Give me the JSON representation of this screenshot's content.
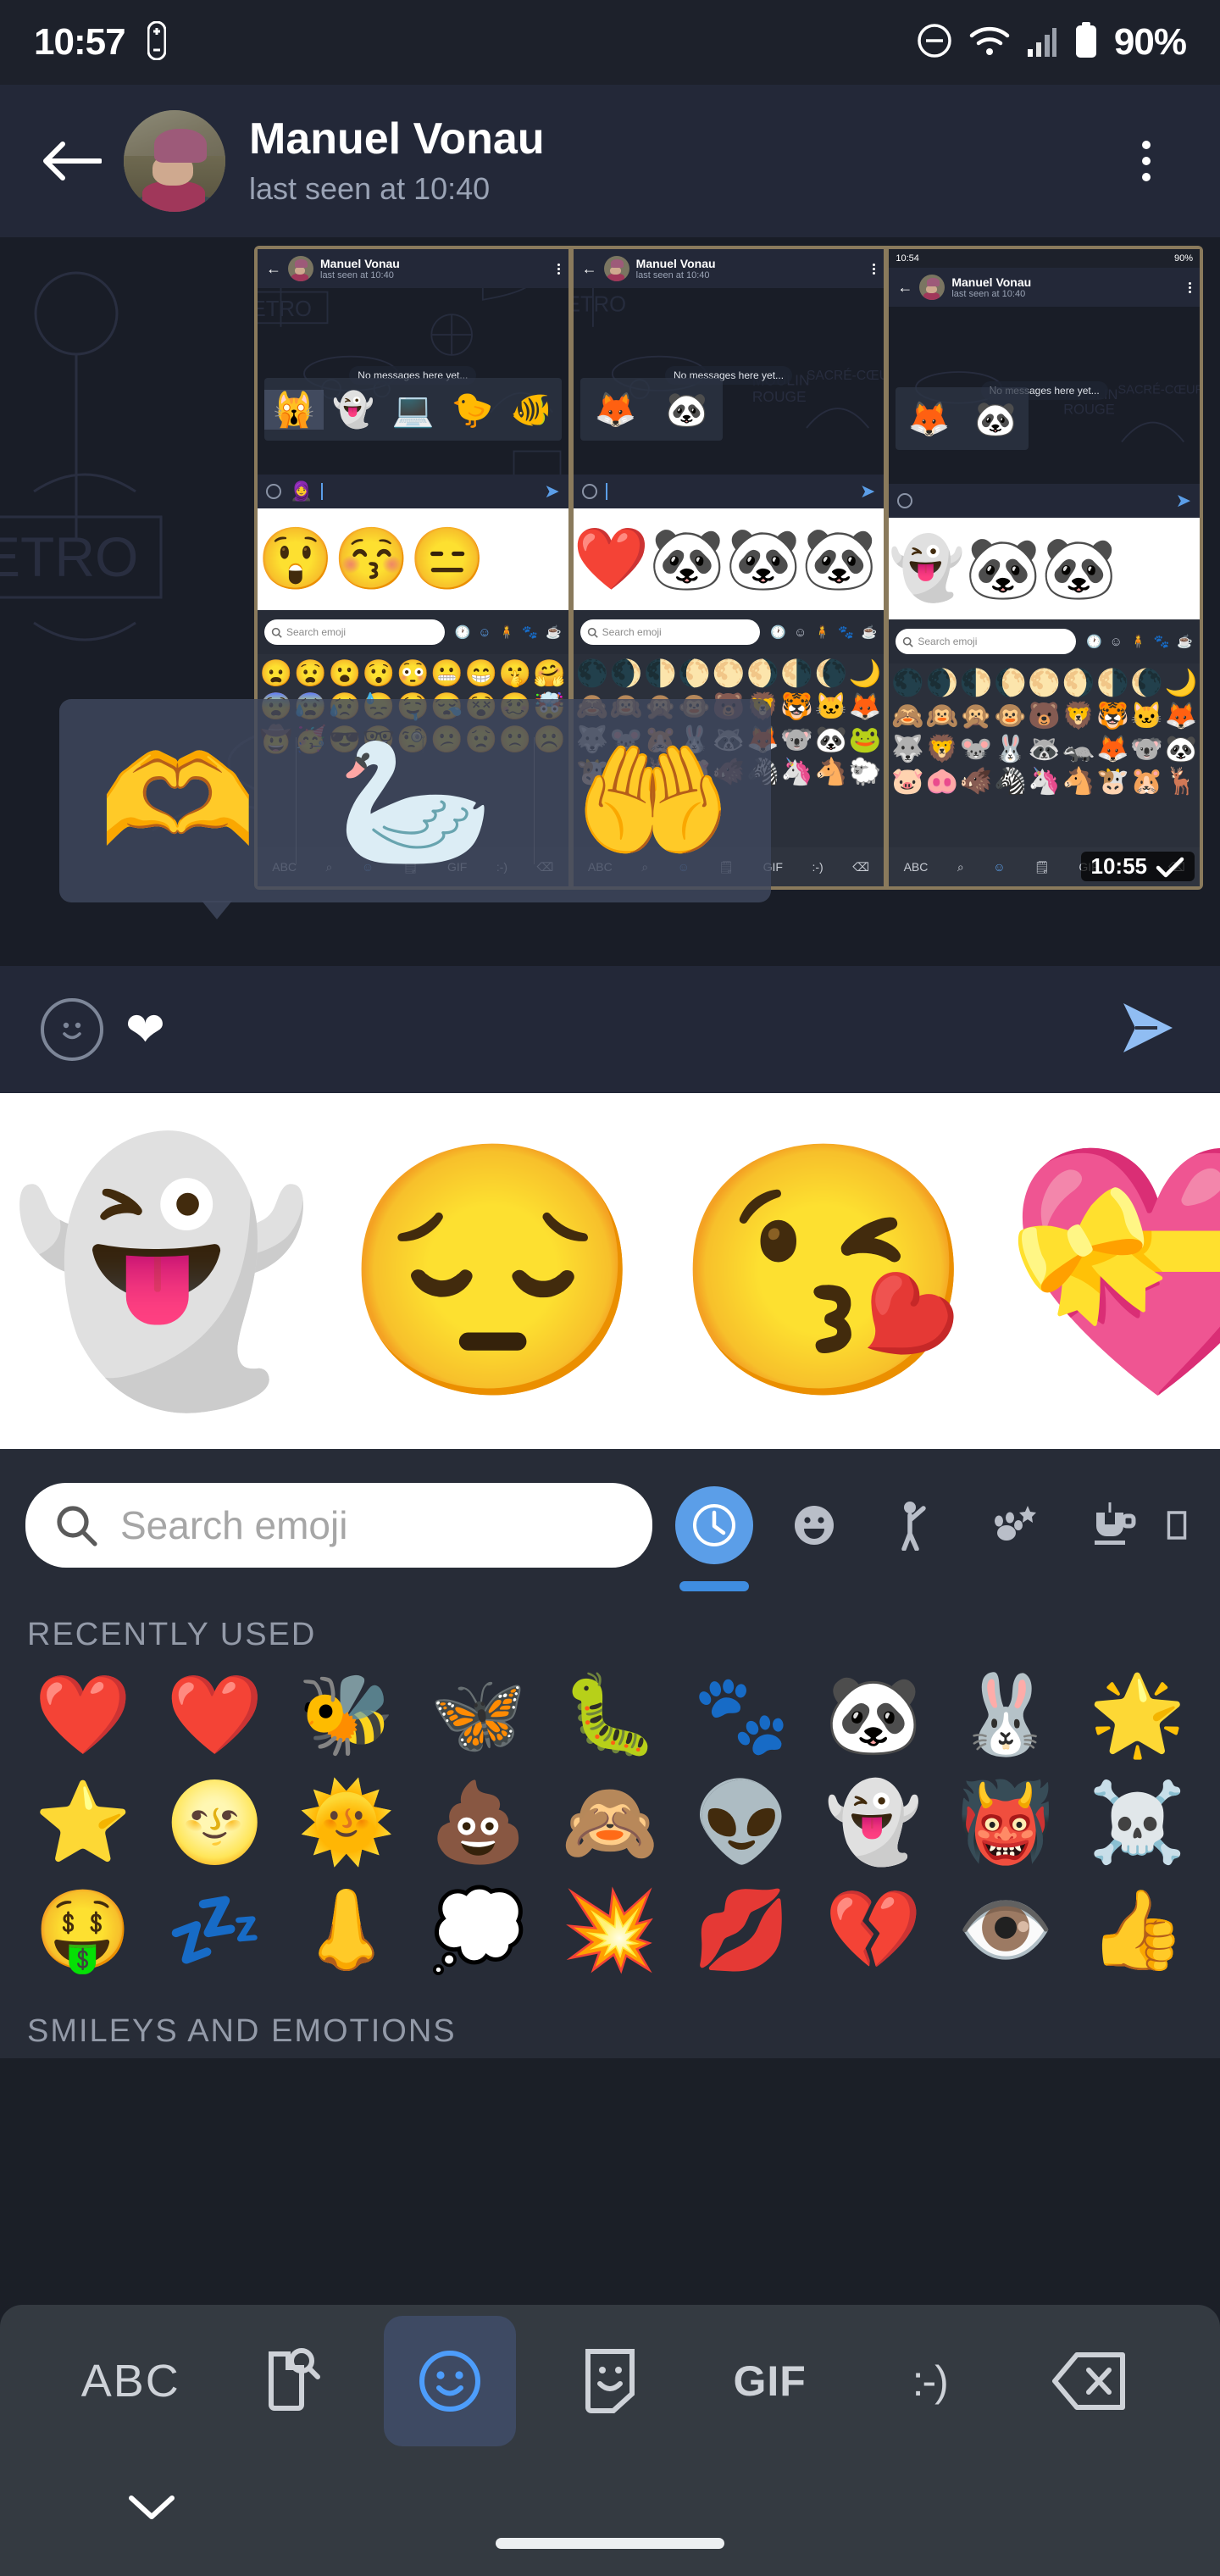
{
  "statusbar": {
    "time": "10:57",
    "battery_percent": "90%",
    "icons": [
      "remote-icon",
      "do-not-disturb-icon",
      "wifi-icon",
      "signal-icon",
      "battery-icon"
    ]
  },
  "header": {
    "title": "Manuel Vonau",
    "subtitle": "last seen at 10:40",
    "back_icon": "back-arrow-icon",
    "menu_icon": "overflow-menu-icon",
    "avatar_name": "contact-avatar"
  },
  "chat": {
    "image_message": {
      "border_color": "#8a7a5c",
      "screenshots": [
        {
          "header_title": "Manuel Vonau",
          "header_subtitle": "last seen at 10:40",
          "empty_text": "No messages here yet...",
          "suggested_stickers": [
            "🙀",
            "👻",
            "💻",
            "🐤",
            "🐠"
          ],
          "input_value": "🧕",
          "preview_emoji": [
            "😲",
            "😚",
            "😑"
          ],
          "search_placeholder": "Search emoji",
          "grid_rows": [
            [
              "😦",
              "😧",
              "😮",
              "😯",
              "😳",
              "😬",
              "😁",
              "🤫",
              "🤗"
            ]
          ],
          "active_tab": "smileys"
        },
        {
          "header_title": "Manuel Vonau",
          "header_subtitle": "last seen at 10:40",
          "empty_text": "No messages here yet...",
          "suggested_stickers": [
            "🦊",
            "🐼"
          ],
          "input_value": "",
          "preview_emoji": [
            "❤️",
            "🐼",
            "🐼",
            "🐼"
          ],
          "search_placeholder": "Search emoji",
          "grid_rows": [
            [
              "🌑",
              "🌒",
              "🌓",
              "🌔",
              "🌕",
              "🌖",
              "🌗",
              "🌘",
              "🌙"
            ],
            [
              "🙈",
              "🙉",
              "🙊",
              "🐵",
              "🐻",
              "🦁",
              "🐯",
              "🐱",
              "🦊"
            ]
          ],
          "active_tab": "animals"
        },
        {
          "status_time": "10:54",
          "status_battery": "90%",
          "header_title": "Manuel Vonau",
          "header_subtitle": "last seen at 10:40",
          "empty_text": "No messages here yet...",
          "suggested_stickers": [
            "🦊",
            "🐼"
          ],
          "input_value": "",
          "preview_emoji": [
            "👻",
            "🐼",
            "🐼"
          ],
          "search_placeholder": "Search emoji",
          "grid_rows": [
            [
              "🌑",
              "🌒",
              "🌓",
              "🌔",
              "🌕",
              "🌖",
              "🌗",
              "🌘",
              "🌙"
            ],
            [
              "🙈",
              "🙉",
              "🙊",
              "🐵",
              "🐻",
              "🦁",
              "🐯",
              "🐱",
              "🦊"
            ],
            [
              "🐺",
              "🦁",
              "🐭",
              "🐰",
              "🦝",
              "🦡",
              "🦊",
              "🐨",
              "🐼"
            ],
            [
              "🐷",
              "🐽",
              "🐗",
              "🦓",
              "🦄",
              "🐴",
              "🐮",
              "🐹",
              "🦌"
            ]
          ],
          "active_tab": "animals",
          "keyboard_label": "ABC",
          "time_overlay": "10:55",
          "check_icon": "checkmark-icon"
        }
      ],
      "sticker_suggestions": [
        "🫶",
        "🦢",
        "🤲"
      ]
    }
  },
  "input_bar": {
    "emoji_button_icon": "smiley-icon",
    "message_text": "❤",
    "send_icon": "send-icon"
  },
  "emoji_kitchen_preview": {
    "items": [
      "👻",
      "😔",
      "😘",
      "💝"
    ]
  },
  "picker": {
    "search": {
      "placeholder": "Search emoji",
      "icon": "search-icon"
    },
    "tabs": [
      {
        "name": "recently-used",
        "icon": "clock-icon",
        "active": true
      },
      {
        "name": "smileys",
        "icon": "smiley-icon",
        "active": false
      },
      {
        "name": "people",
        "icon": "person-icon",
        "active": false
      },
      {
        "name": "animals-nature",
        "icon": "paw-star-icon",
        "active": false
      },
      {
        "name": "food-drink",
        "icon": "cup-icon",
        "active": false
      },
      {
        "name": "travel",
        "icon": "partial-icon",
        "active": false
      }
    ],
    "accent_color": "#5b9ee8",
    "sections": [
      {
        "label": "RECENTLY USED",
        "rows": [
          [
            "❤️",
            "❤️",
            "🐝",
            "🦋",
            "🐛",
            "🐾",
            "🐼",
            "🐰",
            "🌟"
          ],
          [
            "⭐",
            "🌝",
            "🌞",
            "💩",
            "🙈",
            "👽",
            "👻",
            "👹",
            "☠️"
          ],
          [
            "🤑",
            "💤",
            "👃",
            "💭",
            "💥",
            "💋",
            "💔",
            "👁️",
            "👍"
          ]
        ]
      },
      {
        "label": "SMILEYS AND EMOTIONS",
        "rows": []
      }
    ]
  },
  "keyboard_toolbar": {
    "items": [
      {
        "name": "abc-key",
        "label": "ABC",
        "type": "text",
        "active": false
      },
      {
        "name": "sticker-search-key",
        "label": "",
        "type": "icon-sticker-search",
        "active": false
      },
      {
        "name": "emoji-key",
        "label": "",
        "type": "icon-smiley",
        "active": true
      },
      {
        "name": "sticker-key",
        "label": "",
        "type": "icon-sticker",
        "active": false
      },
      {
        "name": "gif-key",
        "label": "GIF",
        "type": "text-gif",
        "active": false
      },
      {
        "name": "emoticon-key",
        "label": ":-)",
        "type": "text-emoticon",
        "active": false
      },
      {
        "name": "backspace-key",
        "label": "",
        "type": "icon-backspace",
        "active": false
      }
    ]
  },
  "navbar": {
    "hide_keyboard_icon": "chevron-down-icon",
    "home_indicator": "home-indicator"
  }
}
